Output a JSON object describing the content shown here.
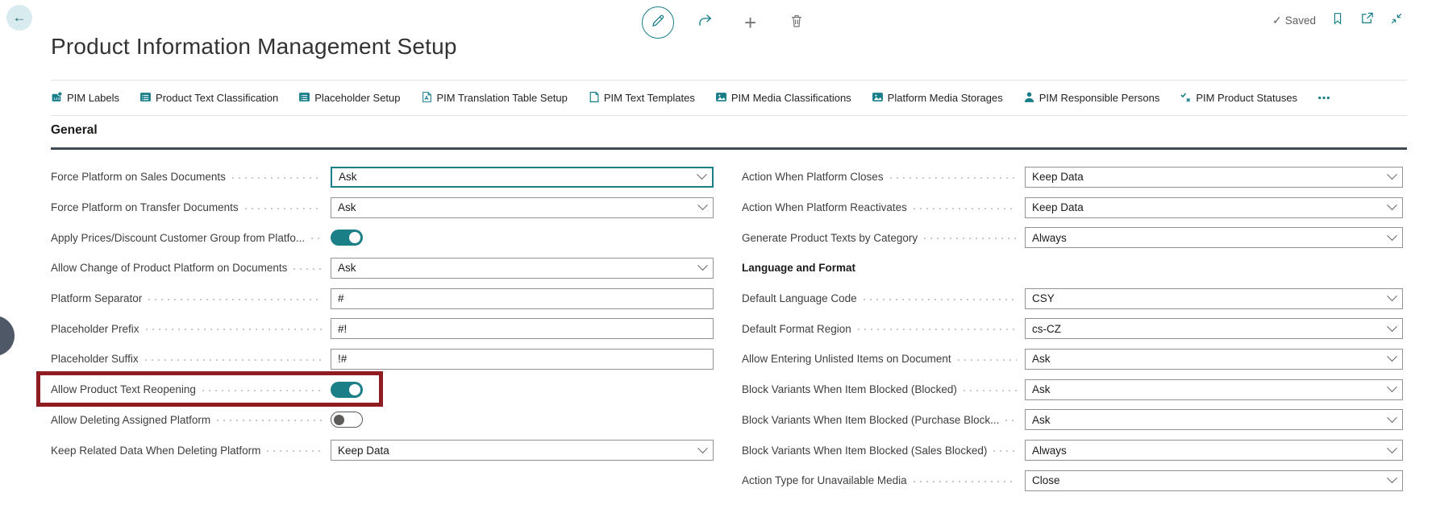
{
  "app": {
    "title": "Product Information Management Setup",
    "saved_label": "Saved"
  },
  "icons": {
    "back": "←",
    "plus": "+",
    "check": "✓"
  },
  "menu": {
    "items": [
      {
        "label": "PIM Labels",
        "icon": "labels-icon"
      },
      {
        "label": "Product Text Classification",
        "icon": "list-icon"
      },
      {
        "label": "Placeholder Setup",
        "icon": "list-icon"
      },
      {
        "label": "PIM Translation Table Setup",
        "icon": "translate-icon"
      },
      {
        "label": "PIM Text Templates",
        "icon": "template-icon"
      },
      {
        "label": "PIM Media Classifications",
        "icon": "media-icon"
      },
      {
        "label": "Platform Media Storages",
        "icon": "media-icon"
      },
      {
        "label": "PIM Responsible Persons",
        "icon": "person-icon"
      },
      {
        "label": "PIM Product Statuses",
        "icon": "statuses-icon"
      }
    ],
    "more": "⋯"
  },
  "section": {
    "title": "General"
  },
  "fields": {
    "left": [
      {
        "label": "Force Platform on Sales Documents",
        "type": "combobox",
        "value": "Ask",
        "focused": true
      },
      {
        "label": "Force Platform on Transfer Documents",
        "type": "combobox",
        "value": "Ask"
      },
      {
        "label": "Apply Prices/Discount Customer Group from Platfo...",
        "type": "toggle",
        "value": "on"
      },
      {
        "label": "Allow Change of Product Platform on Documents",
        "type": "combobox",
        "value": "Ask"
      },
      {
        "label": "Platform Separator",
        "type": "text",
        "value": "#"
      },
      {
        "label": "Placeholder Prefix",
        "type": "text",
        "value": "#!"
      },
      {
        "label": "Placeholder Suffix",
        "type": "text",
        "value": "!#"
      },
      {
        "label": "Allow Product Text Reopening",
        "type": "toggle",
        "value": "on",
        "highlighted": true
      },
      {
        "label": "Allow Deleting Assigned Platform",
        "type": "toggle",
        "value": "off"
      },
      {
        "label": "Keep Related Data When Deleting Platform",
        "type": "combobox",
        "value": "Keep Data"
      }
    ],
    "right": [
      {
        "label": "Action When Platform Closes",
        "type": "combobox",
        "value": "Keep Data"
      },
      {
        "label": "Action When Platform Reactivates",
        "type": "combobox",
        "value": "Keep Data"
      },
      {
        "label": "Generate Product Texts by Category",
        "type": "combobox",
        "value": "Always"
      },
      {
        "label": "Language and Format",
        "type": "subheader"
      },
      {
        "label": "Default Language Code",
        "type": "combobox",
        "value": "CSY"
      },
      {
        "label": "Default Format Region",
        "type": "combobox",
        "value": "cs-CZ"
      },
      {
        "label": "Allow Entering Unlisted Items on Document",
        "type": "combobox",
        "value": "Ask"
      },
      {
        "label": "Block Variants When Item Blocked (Blocked)",
        "type": "combobox",
        "value": "Ask"
      },
      {
        "label": "Block Variants When Item Blocked (Purchase Block...",
        "type": "combobox",
        "value": "Ask"
      },
      {
        "label": "Block Variants When Item Blocked (Sales Blocked)",
        "type": "combobox",
        "value": "Always"
      },
      {
        "label": "Action Type for Unavailable Media",
        "type": "combobox",
        "value": "Close"
      }
    ]
  },
  "colors": {
    "accent": "#1a7f87",
    "toggle_on": "#1a7f87",
    "highlight_border": "#8e1c21",
    "section_underline": "#404a53",
    "back_circle_bg": "#d8ebee"
  }
}
